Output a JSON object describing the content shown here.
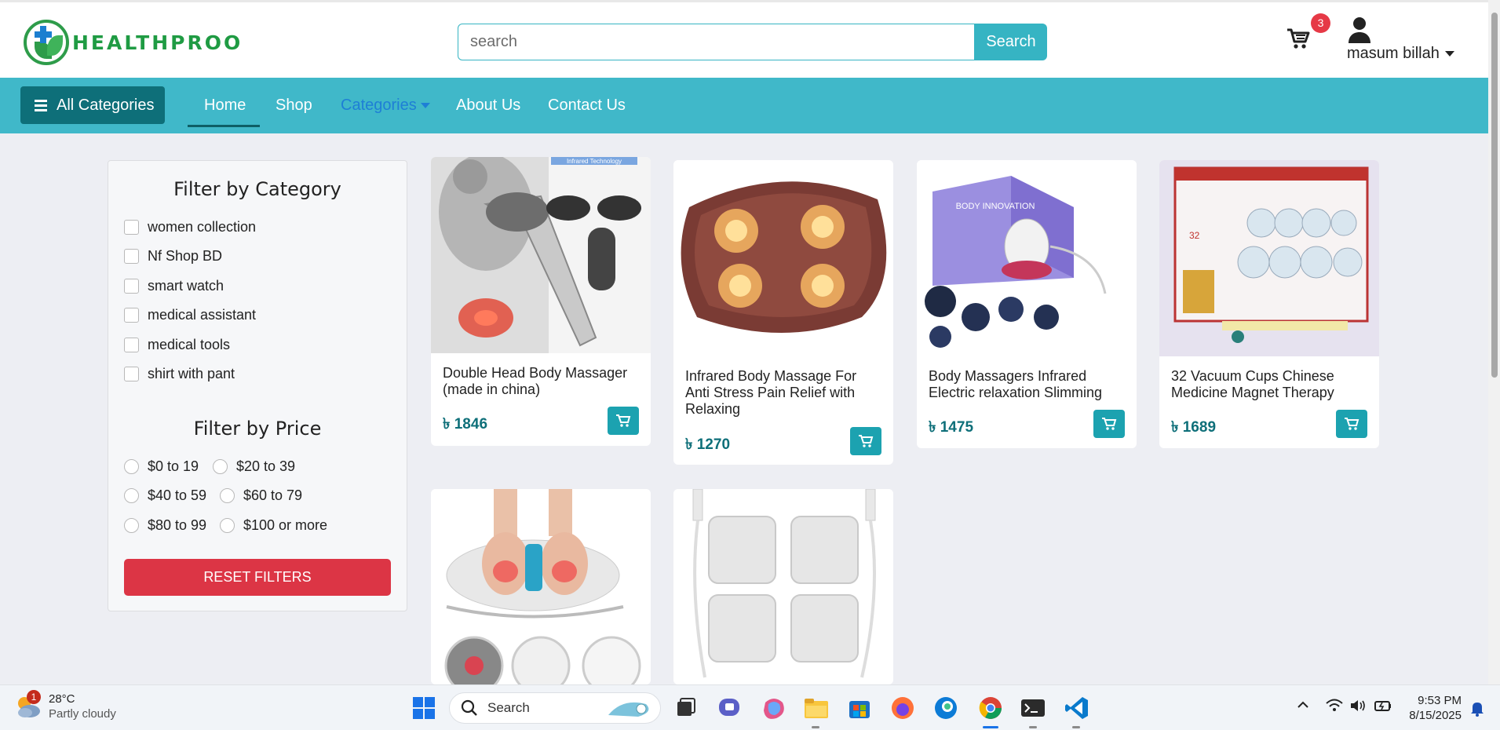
{
  "brand": {
    "name": "HEALTHPROO"
  },
  "search": {
    "placeholder": "search",
    "button_label": "Search"
  },
  "cart": {
    "count": "3"
  },
  "user": {
    "name": "masum billah"
  },
  "nav": {
    "all_categories": "All Categories",
    "links": [
      "Home",
      "Shop",
      "Categories",
      "About Us",
      "Contact Us"
    ],
    "active": "Home"
  },
  "filters": {
    "category_title": "Filter by Category",
    "categories": [
      "women collection",
      "Nf Shop BD",
      "smart watch",
      "medical assistant",
      "medical tools",
      "shirt with pant"
    ],
    "price_title": "Filter by Price",
    "prices": [
      "$0 to 19",
      "$20 to 39",
      "$40 to 59",
      "$60 to 79",
      "$80 to 99",
      "$100 or more"
    ],
    "reset_label": "RESET FILTERS"
  },
  "products": [
    {
      "title": "Double Head Body Massager (made in china)",
      "price": "৳ 1846",
      "image_text": "Infrared Technology"
    },
    {
      "title": "Infrared Body Massage For Anti Stress Pain Relief with Relaxing",
      "price": "৳ 1270"
    },
    {
      "title": "Body Massagers Infrared Electric relaxation Slimming",
      "price": "৳ 1475",
      "image_text": "BODY INNOVATION"
    },
    {
      "title": "32 Vacuum Cups Chinese Medicine Magnet Therapy",
      "price": "৳ 1689",
      "image_text": "32"
    },
    {
      "title": "",
      "price": ""
    },
    {
      "title": "",
      "price": ""
    }
  ],
  "taskbar": {
    "weather_badge": "1",
    "temperature": "28°C",
    "condition": "Partly cloudy",
    "search_label": "Search",
    "time": "9:53 PM",
    "date": "8/15/2025"
  }
}
